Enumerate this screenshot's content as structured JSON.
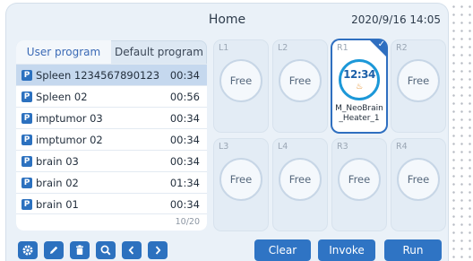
{
  "header": {
    "title": "Home",
    "datetime": "2020/9/16 14:05"
  },
  "tabs": [
    {
      "label": "User program",
      "active": true
    },
    {
      "label": "Default program",
      "active": false
    }
  ],
  "programs": [
    {
      "badge": "P",
      "name": "Spleen 1234567890123",
      "time": "00:34",
      "selected": true
    },
    {
      "badge": "P",
      "name": "Spleen 02",
      "time": "00:56"
    },
    {
      "badge": "P",
      "name": "imptumor 03",
      "time": "00:34"
    },
    {
      "badge": "P",
      "name": "imptumor 02",
      "time": "00:34"
    },
    {
      "badge": "P",
      "name": "brain 03",
      "time": "00:34"
    },
    {
      "badge": "P",
      "name": "brain 02",
      "time": "01:34"
    },
    {
      "badge": "P",
      "name": "brain 01",
      "time": "00:34"
    }
  ],
  "pager": "10/20",
  "slots": [
    {
      "id": "L1",
      "state": "Free"
    },
    {
      "id": "L2",
      "state": "Free"
    },
    {
      "id": "R1",
      "active": true,
      "clock": "12:34",
      "steam": "♨",
      "name_line1": "M_NeoBrain",
      "name_line2": "_Heater_1"
    },
    {
      "id": "R2",
      "state": "Free"
    },
    {
      "id": "L3",
      "state": "Free"
    },
    {
      "id": "L4",
      "state": "Free"
    },
    {
      "id": "R3",
      "state": "Free"
    },
    {
      "id": "R4",
      "state": "Free"
    }
  ],
  "toolbar": {
    "icons": [
      "gear-icon",
      "pencil-icon",
      "trash-icon",
      "search-icon",
      "chevron-left-icon",
      "chevron-right-icon"
    ]
  },
  "actions": {
    "clear": "Clear",
    "invoke": "Invoke",
    "run": "Run"
  },
  "colors": {
    "accent": "#2f74c4",
    "selected_row": "#c5d8ee",
    "ring_active": "#1c98d8",
    "steam": "#e58a1f"
  }
}
